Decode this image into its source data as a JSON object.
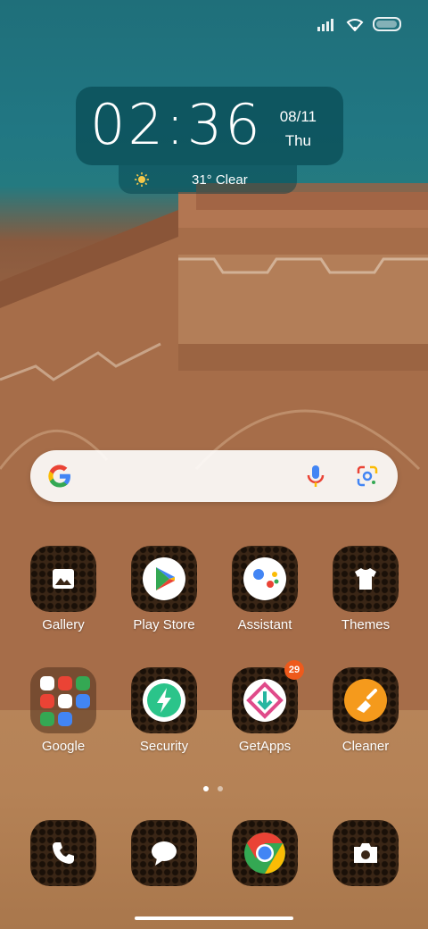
{
  "status": {
    "signal": "signal-icon",
    "wifi": "wifi-icon",
    "battery": "battery-icon"
  },
  "clock": {
    "time": "02:36",
    "date": "08/11",
    "day": "Thu"
  },
  "weather": {
    "icon": "sun-icon",
    "text": "31° Clear"
  },
  "search": {
    "logo": "google-g-icon",
    "mic": "mic-icon",
    "lens": "lens-icon"
  },
  "apps": {
    "gallery": "Gallery",
    "playstore": "Play Store",
    "assistant": "Assistant",
    "themes": "Themes",
    "google": "Google",
    "security": "Security",
    "getapps": "GetApps",
    "getapps_badge": "29",
    "cleaner": "Cleaner"
  },
  "page_indicator": {
    "count": 2,
    "active": 1
  },
  "dock": [
    "phone-icon",
    "messages-icon",
    "chrome-icon",
    "camera-icon"
  ],
  "colors": {
    "sky": "#217783",
    "wall": "#b07a52",
    "badge": "#ee5a1c",
    "tile": "#3a2616"
  }
}
